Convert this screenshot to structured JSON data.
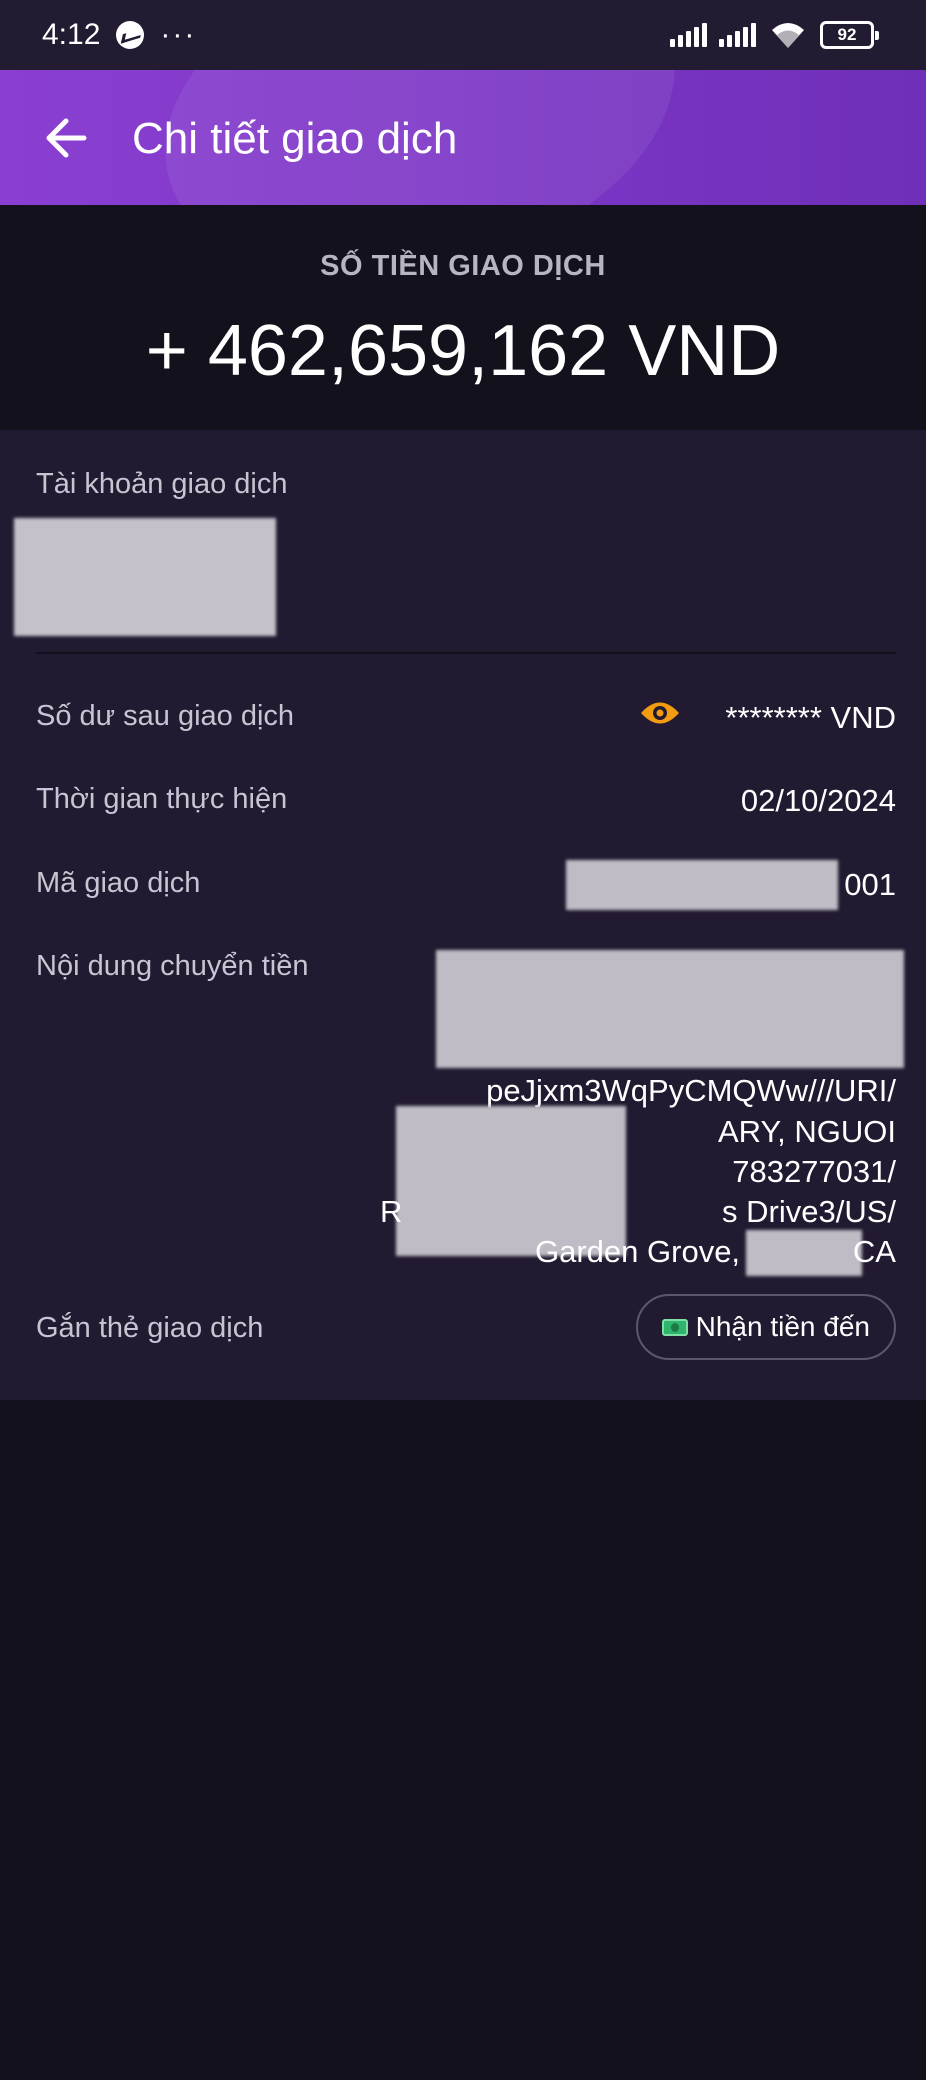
{
  "status_bar": {
    "time": "4:12",
    "dots": "···",
    "battery": "92"
  },
  "app_bar": {
    "title": "Chi tiết giao dịch"
  },
  "amount": {
    "label": "SỐ TIỀN GIAO DỊCH",
    "value": "+ 462,659,162 VND"
  },
  "details": {
    "account_label": "Tài khoản giao dịch",
    "balance_label": "Số dư sau giao dịch",
    "balance_value": "******** VND",
    "time_label": "Thời gian thực hiện",
    "time_value": "02/10/2024",
    "code_label": "Mã giao dịch",
    "code_suffix": "001",
    "content_label": "Nội dung chuyển tiền",
    "content_line_4": "peJjxm3WqPyCMQWw///URI/",
    "content_line_5_suffix": "ARY, NGUOI",
    "content_line_6_suffix": "783277031/",
    "content_line_7_prefix": "R",
    "content_line_7_suffix": "s Drive3/US/",
    "content_line_8_prefix": "Garden Grove,",
    "content_line_8_suffix": "CA",
    "tag_label": "Gắn thẻ giao dịch",
    "tag_chip": "Nhận tiền đến"
  },
  "colors": {
    "app_bar": "#7a35c4",
    "background": "#13111c",
    "card": "#221a30",
    "eye": "#f39c12",
    "money": "#2fb56b"
  }
}
